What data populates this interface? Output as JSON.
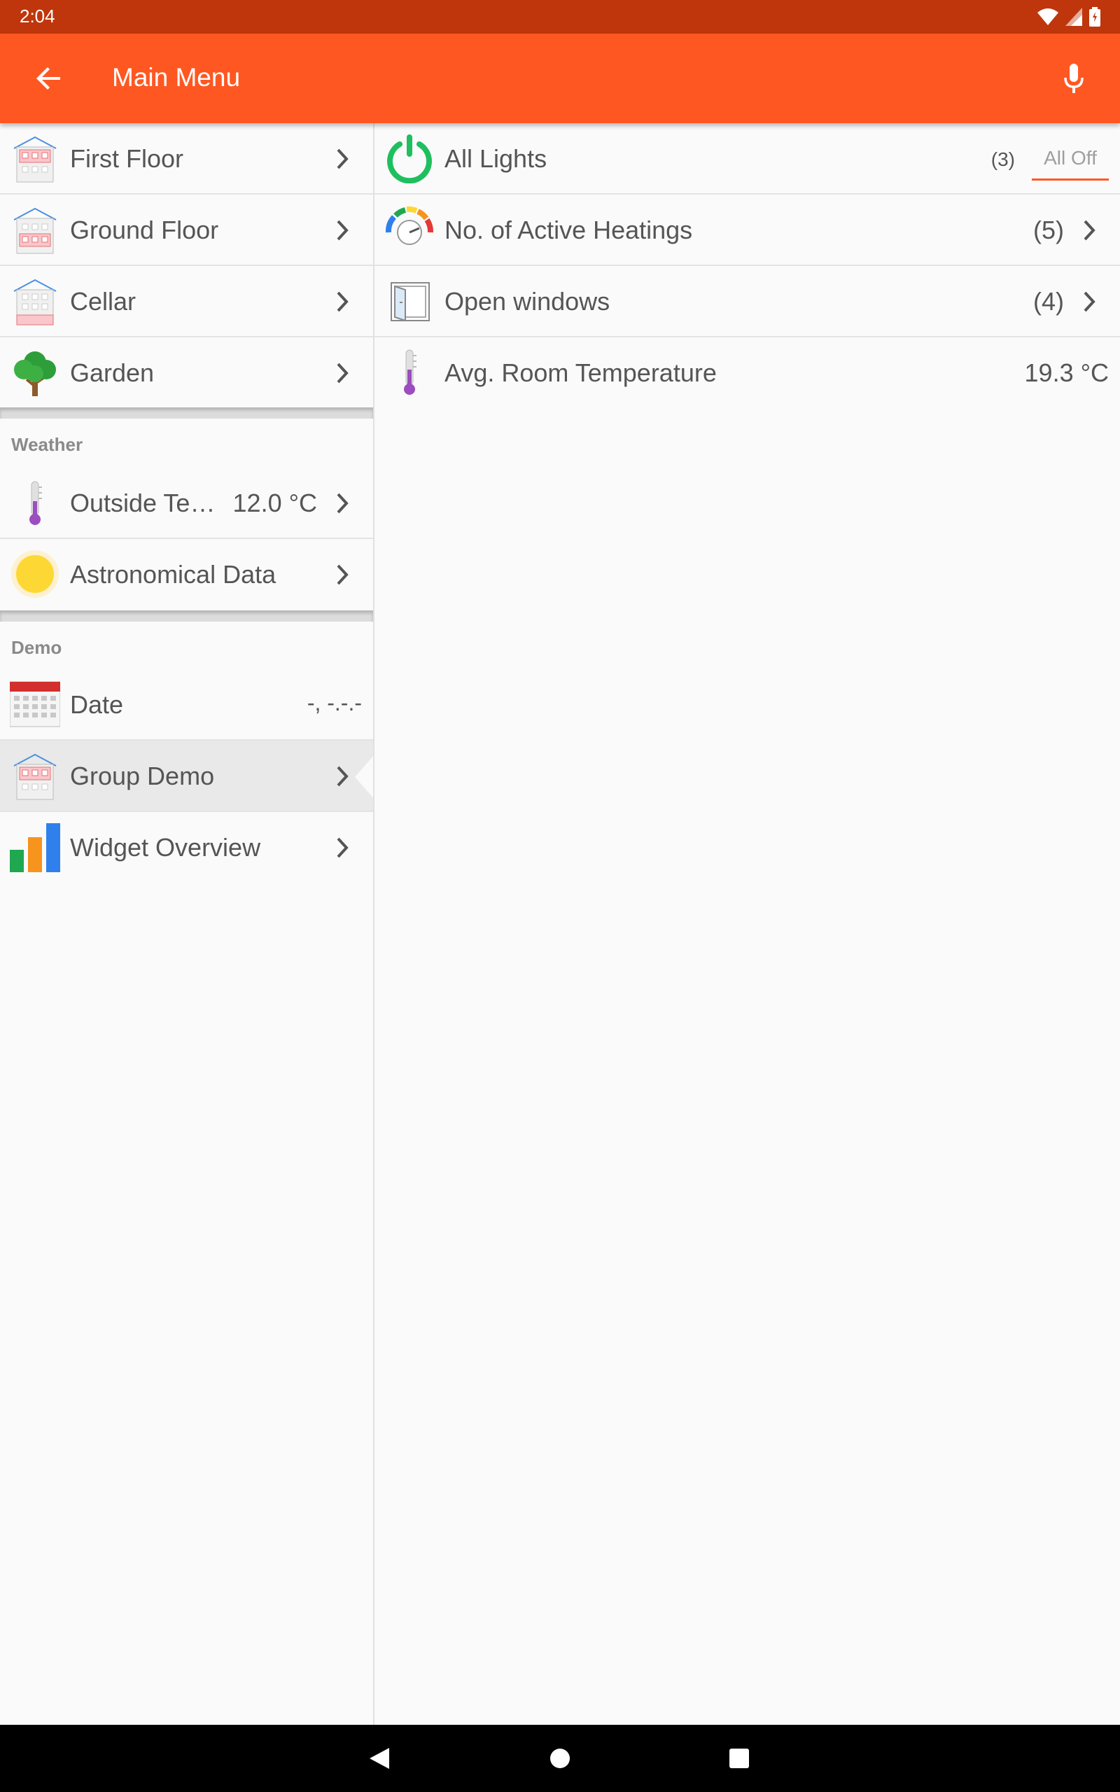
{
  "status_bar": {
    "time": "2:04"
  },
  "app_bar": {
    "title": "Main Menu"
  },
  "left_pane": {
    "floors": [
      {
        "label": "First Floor"
      },
      {
        "label": "Ground Floor"
      },
      {
        "label": "Cellar"
      },
      {
        "label": "Garden"
      }
    ],
    "weather": {
      "header": "Weather",
      "items": [
        {
          "label": "Outside Te…",
          "value": "12.0 °C"
        },
        {
          "label": "Astronomical Data"
        }
      ]
    },
    "demo": {
      "header": "Demo",
      "items": [
        {
          "label": "Date",
          "value": "-, -.-.-"
        },
        {
          "label": "Group Demo"
        },
        {
          "label": "Widget Overview"
        }
      ]
    }
  },
  "right_pane": {
    "items": [
      {
        "label": "All Lights",
        "count": "(3)",
        "action": "All Off"
      },
      {
        "label": "No. of Active Heatings",
        "count": "(5)"
      },
      {
        "label": "Open windows",
        "count": "(4)"
      },
      {
        "label": "Avg. Room Temperature",
        "value": "19.3 °C"
      }
    ]
  },
  "colors": {
    "status_bar": "#bf360c",
    "app_bar": "#ff5722",
    "accent": "#ff5722",
    "power_green": "#1fbf5f"
  }
}
